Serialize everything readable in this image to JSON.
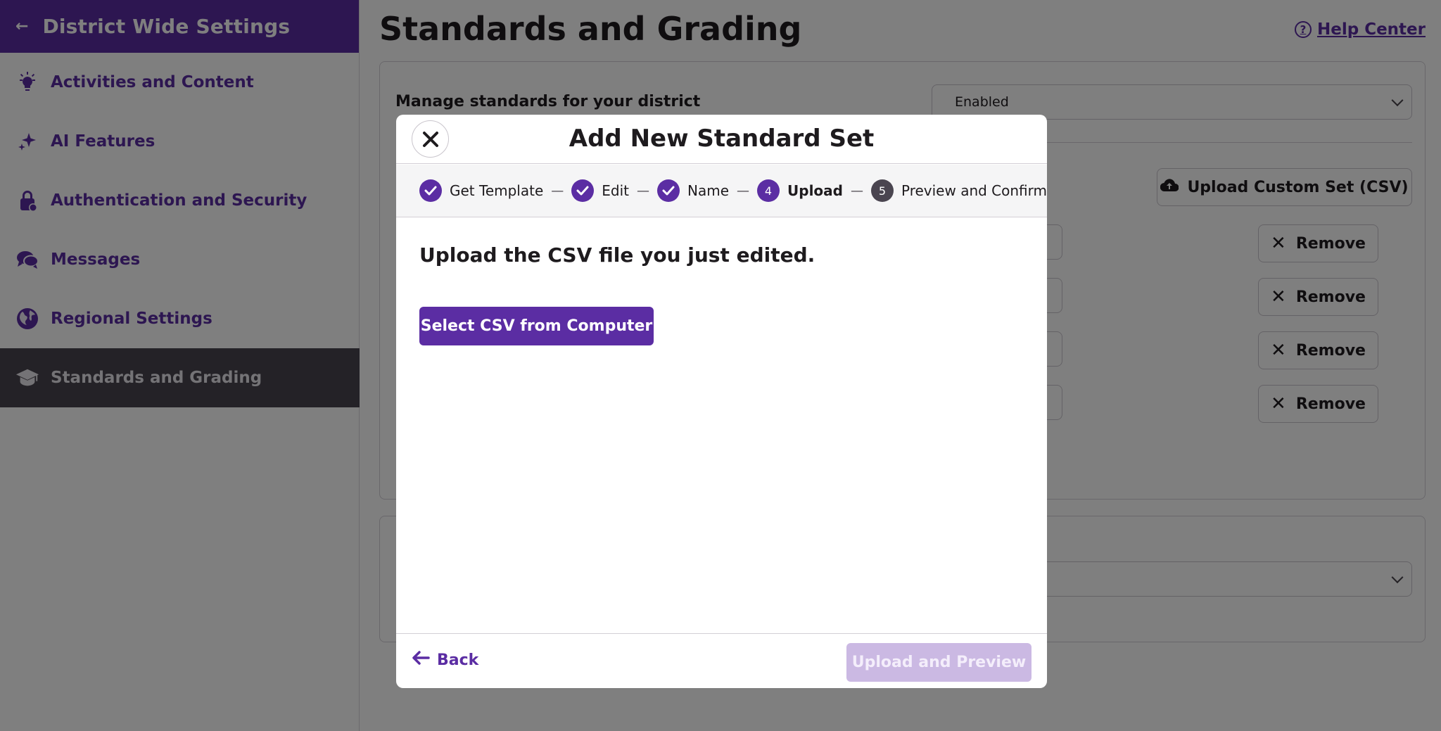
{
  "sidebar": {
    "back_arrow": "←",
    "title": "District Wide Settings",
    "items": [
      {
        "label": "Activities and Content",
        "icon": "lightbulb-icon"
      },
      {
        "label": "AI Features",
        "icon": "sparkle-icon"
      },
      {
        "label": "Authentication and Security",
        "icon": "lock-icon"
      },
      {
        "label": "Messages",
        "icon": "chat-bubbles-icon"
      },
      {
        "label": "Regional Settings",
        "icon": "globe-icon"
      },
      {
        "label": "Standards and Grading",
        "icon": "graduation-cap-icon",
        "active": true
      }
    ]
  },
  "main": {
    "page_title": "Standards and Grading",
    "help_label": "Help Center",
    "manage_label": "Manage standards for your district",
    "manage_value": "Enabled",
    "upload_custom_label": "Upload Custom Set (CSV)",
    "remove_label": "Remove",
    "remove_glyph": "✕"
  },
  "modal": {
    "close_glyph": "✕",
    "title": "Add New Standard Set",
    "steps": [
      {
        "number": "1",
        "label": "Get Template",
        "state": "done"
      },
      {
        "number": "2",
        "label": "Edit",
        "state": "done"
      },
      {
        "number": "3",
        "label": "Name",
        "state": "done"
      },
      {
        "number": "4",
        "label": "Upload",
        "state": "current"
      },
      {
        "number": "5",
        "label": "Preview and Confirm",
        "state": "future"
      }
    ],
    "step_separator": "—",
    "prompt": "Upload the CSV file you just edited.",
    "select_button": "Select CSV from Computer",
    "back_label": "Back",
    "upload_preview_label": "Upload and Preview"
  },
  "colors": {
    "brand_purple": "#5b2da3",
    "active_nav": "#49454f",
    "disabled_button": "#cbb9e3"
  }
}
